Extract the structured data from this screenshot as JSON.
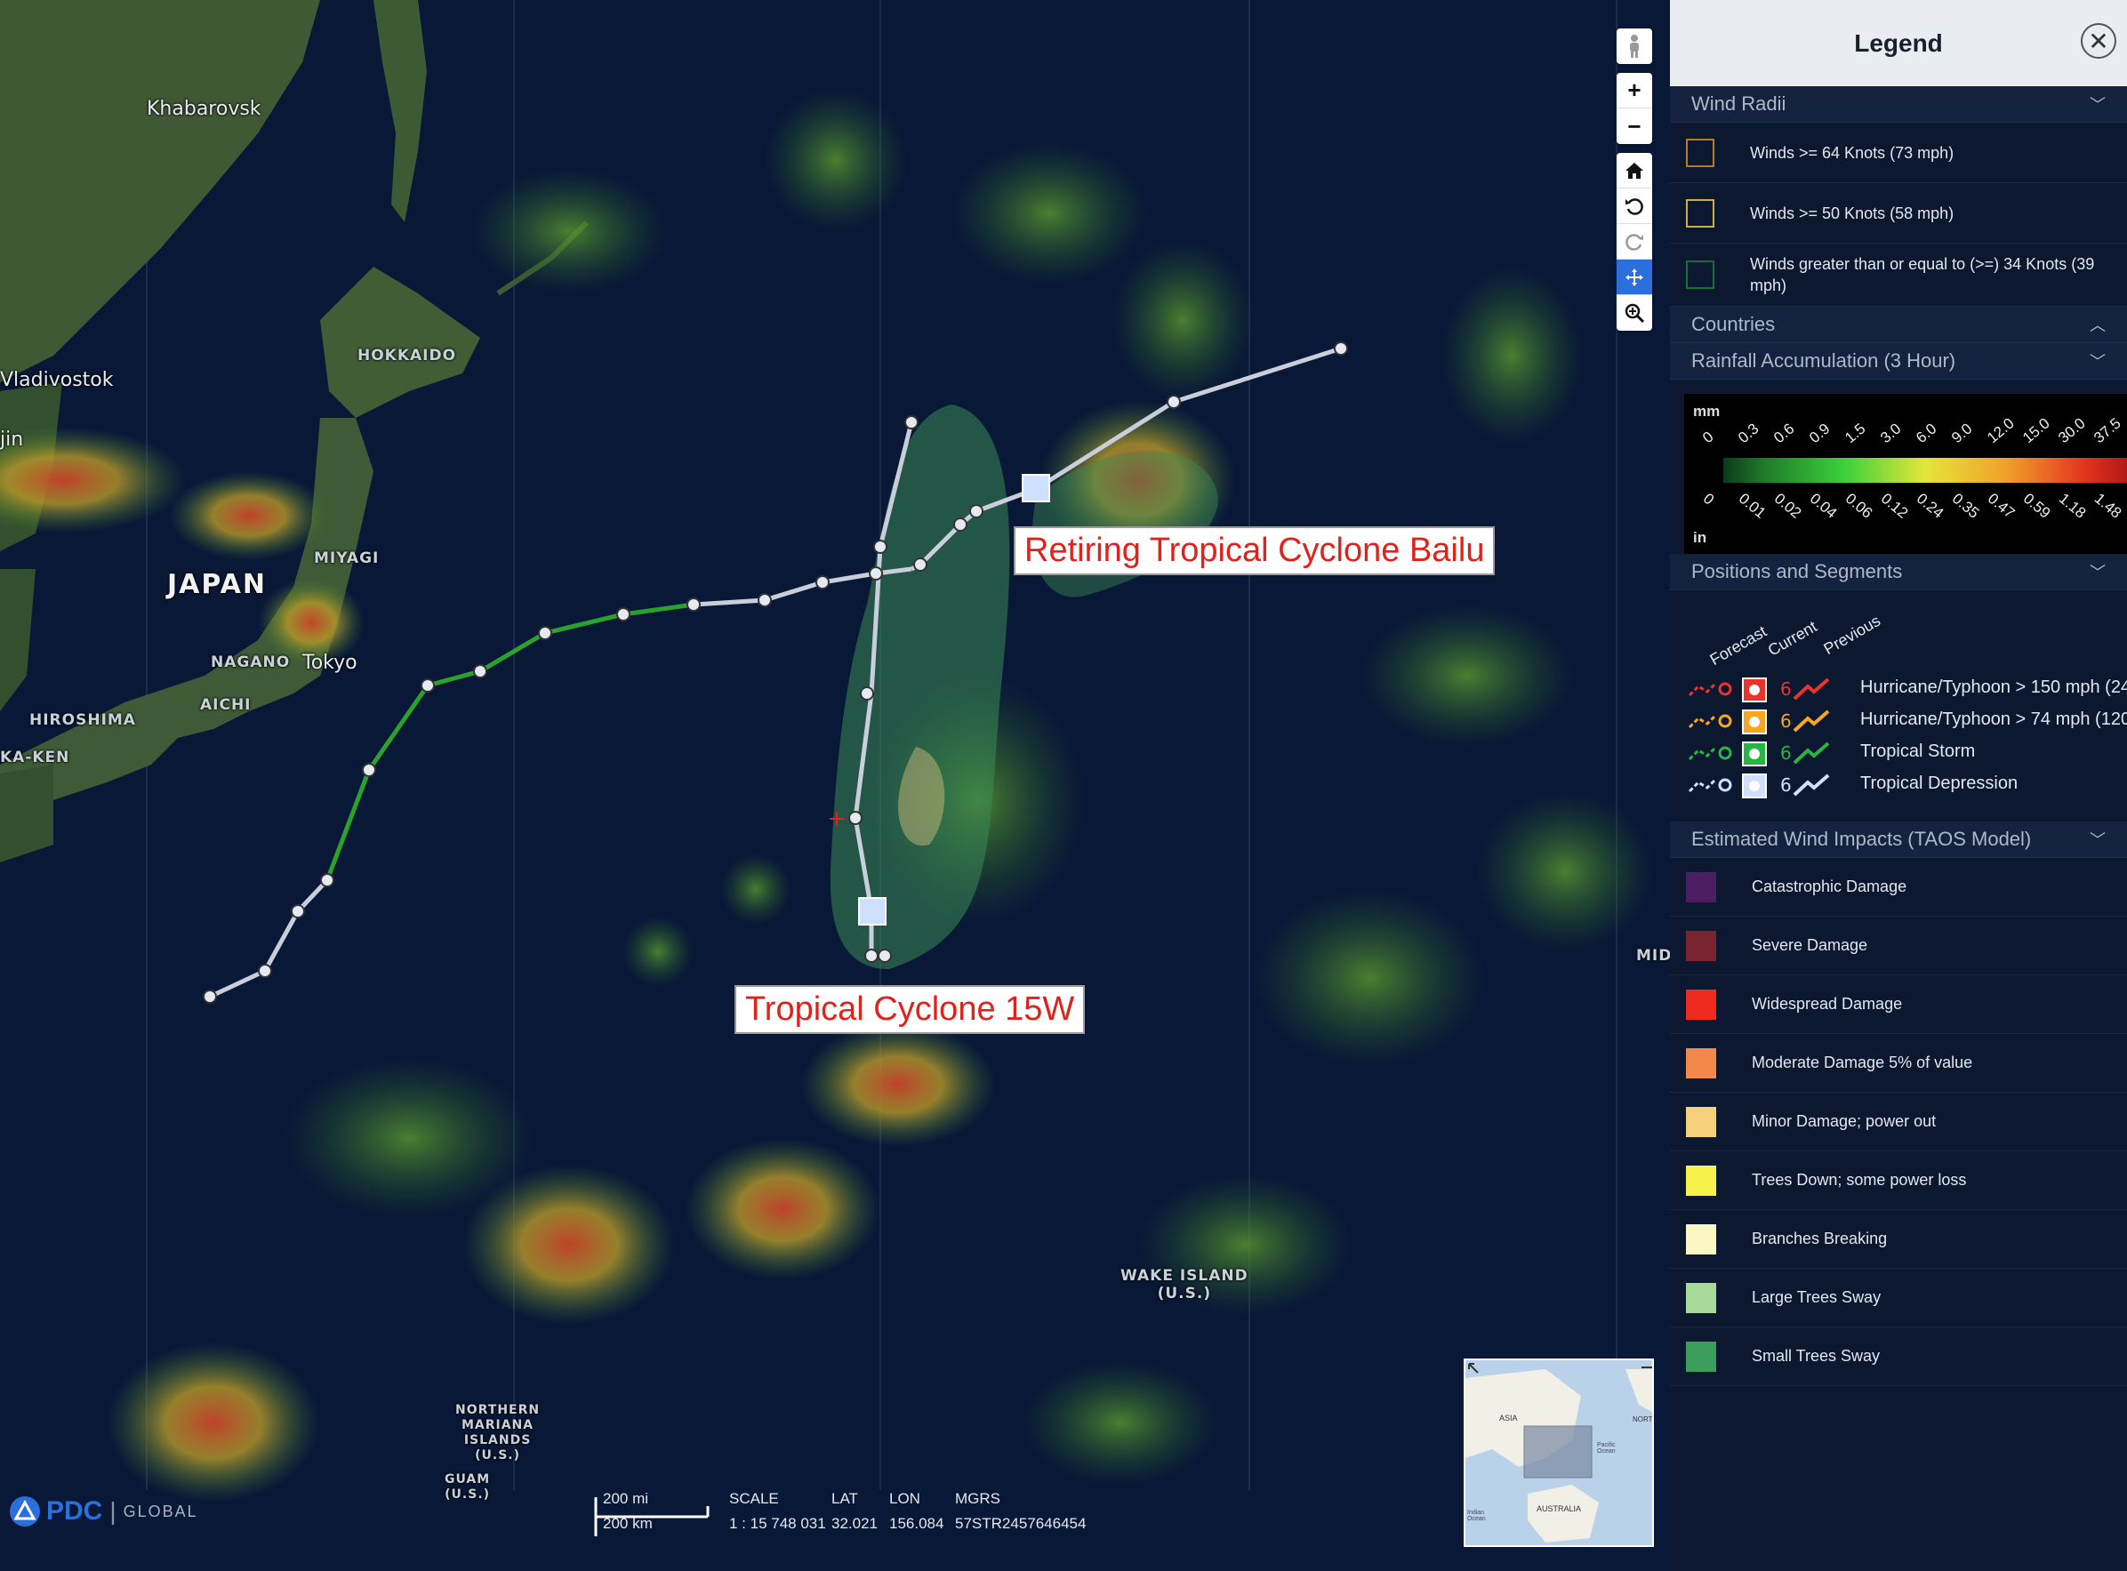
{
  "map": {
    "places": {
      "khabarovsk": "Khabarovsk",
      "vladivostok": "Vladivostok",
      "hokkaido": "HOKKAIDO",
      "japan": "JAPAN",
      "miyagi": "MIYAGI",
      "nagano": "NAGANO",
      "tokyo": "Tokyo",
      "aichi": "AICHI",
      "hiroshima": "HIROSHIMA",
      "ka_ken": "KA-KEN",
      "jin": "jin",
      "wake_island": "WAKE ISLAND",
      "wake_island_sub": "(U.S.)",
      "northern_mariana": "NORTHERN",
      "northern_mariana_2": "MARIANA",
      "northern_mariana_3": "ISLANDS",
      "northern_mariana_4": "(U.S.)",
      "guam": "GUAM",
      "guam_sub": "(U.S.)",
      "mid": "MID"
    },
    "storm_labels": {
      "bailu": "Retiring Tropical Cyclone Bailu",
      "cyclone_15w": "Tropical Cyclone 15W"
    },
    "colors": {
      "forecast_track": "#c7ccd9",
      "previous_track": "#27a12b",
      "label_text": "#e0221b"
    }
  },
  "toolbar": {
    "buttons": [
      "person-icon",
      "zoom-in-icon",
      "zoom-out-icon",
      "home-icon",
      "rotate-left-icon",
      "rotate-right-icon",
      "pan-icon",
      "zoom-box-icon"
    ],
    "zoom_in": "+",
    "zoom_out": "−"
  },
  "status_bar": {
    "scale_mi": "200 mi",
    "scale_km": "200 km",
    "scale_head": "SCALE",
    "scale_val": "1 : 15 748 031",
    "lat_head": "LAT",
    "lat_val": "32.021",
    "lon_head": "LON",
    "lon_val": "156.084",
    "mgrs_head": "MGRS",
    "mgrs_val": "57STR2457646454"
  },
  "logo": {
    "pdc": "PDC",
    "sep": "|",
    "global": "GLOBAL"
  },
  "overview": {
    "asia": "ASIA",
    "australia": "AUSTRALIA",
    "pacific": "Pacific Ocean",
    "indian": "Indian Ocean",
    "nort": "NORT"
  },
  "legend": {
    "title": "Legend",
    "close": "✕",
    "sections": {
      "wind_radii": "Wind Radii",
      "countries": "Countries",
      "rainfall": "Rainfall Accumulation (3 Hour)",
      "positions": "Positions and Segments",
      "impacts": "Estimated Wind Impacts (TAOS Model)"
    },
    "wind_radii": [
      {
        "label": "Winds >= 64 Knots (73 mph)",
        "color": "#b87a2a"
      },
      {
        "label": "Winds >= 50 Knots (58 mph)",
        "color": "#c9b042"
      },
      {
        "label": "Winds greater than or equal to (>=) 34 Knots (39 mph)",
        "color": "#1d6b3a"
      }
    ],
    "rainfall": {
      "unit_mm": "mm",
      "unit_in": "in",
      "mm_ticks": [
        "0",
        "0.3",
        "0.6",
        "0.9",
        "1.5",
        "3.0",
        "6.0",
        "9.0",
        "12.0",
        "15.0",
        "30.0",
        "37.5"
      ],
      "in_ticks": [
        "0",
        "0.01",
        "0.02",
        "0.04",
        "0.06",
        "0.12",
        "0.24",
        "0.35",
        "0.47",
        "0.59",
        "1.18",
        "1.48"
      ]
    },
    "positions": {
      "col_forecast": "Forecast",
      "col_current": "Current",
      "col_previous": "Previous",
      "rows": [
        {
          "label": "Hurricane/Typhoon > 150 mph (24",
          "color": "#e8342a"
        },
        {
          "label": "Hurricane/Typhoon > 74 mph (120",
          "color": "#f5a623"
        },
        {
          "label": "Tropical Storm",
          "color": "#27b544"
        },
        {
          "label": "Tropical Depression",
          "color": "#cfe0ff"
        }
      ]
    },
    "impacts": [
      {
        "label": "Catastrophic Damage",
        "color": "#4b1d63"
      },
      {
        "label": "Severe Damage",
        "color": "#7a2431"
      },
      {
        "label": "Widespread Damage",
        "color": "#ee2a1e"
      },
      {
        "label": "Moderate Damage 5% of value",
        "color": "#f2884a"
      },
      {
        "label": "Minor Damage; power out",
        "color": "#f6d07a"
      },
      {
        "label": "Trees Down; some power loss",
        "color": "#f7f24a"
      },
      {
        "label": "Branches Breaking",
        "color": "#fbf7c4"
      },
      {
        "label": "Large Trees Sway",
        "color": "#a6d99a"
      },
      {
        "label": "Small Trees Sway",
        "color": "#3a9d5a"
      }
    ]
  }
}
